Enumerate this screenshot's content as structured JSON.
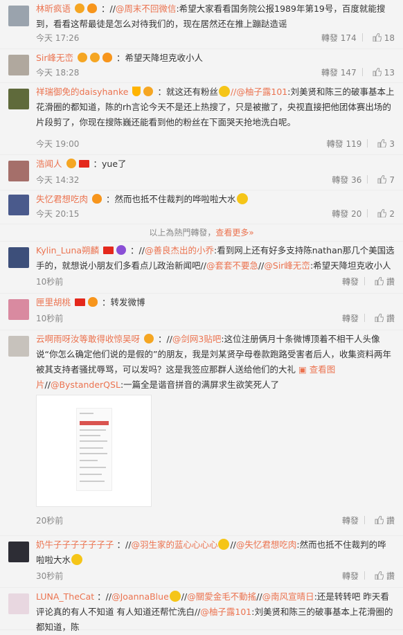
{
  "comments": [
    {
      "user": "林昕疯语",
      "body_prefix": "：//",
      "mention1": "@周末不回微信",
      "text1": ":希望大家看看国务院公报1989年第19号，百度就能搜到，看看这帮最徒是怎么对待我们的，现在居然还在推上蹦跶造谣",
      "time": "今天 17:26",
      "repost": "轉發 174",
      "likes": "18"
    },
    {
      "user": "Sir峰无峦",
      "body_prefix": "：",
      "text1": "希望天降坦克收小人",
      "time": "今天 18:28",
      "repost": "轉發 147",
      "likes": "13"
    },
    {
      "user": "祥瑞御免的daisyhanke",
      "body_prefix": "：就这还有粉丝",
      "mention1": "//@柚子露101",
      "text1": ":刘美贤和陈三的破事基本上花滑圈的都知道，陈的rh言论今天不是还上热搜了，只是被撤了，央视直接把他团体赛出场的片段剪了，你现在搜陈巍还能看到他的粉丝在下面哭天抢地洗白呢。",
      "time": "今天 19:00",
      "repost": "轉發 119",
      "likes": "3"
    },
    {
      "user": "浩闻人",
      "body_prefix": "：",
      "text1": "yue了",
      "time": "今天 14:32",
      "repost": "轉發 36",
      "likes": "7"
    },
    {
      "user": "失忆君想吃肉",
      "body_prefix": "：",
      "text1": "然而也抵不住裁判的哗啦啦大水",
      "time": "今天 20:15",
      "repost": "轉發 20",
      "likes": "2"
    },
    {
      "user": "Kylin_Luna朔麟",
      "body_prefix": "：//",
      "mention1": "@善良杰出的小乔",
      "text1": ":看到网上还有好多支持陈nathan那几个美国选手的，就想说小朋友们多看点儿政治新闻吧//",
      "mention2": "@套套不要急",
      "text2": "//",
      "mention3": "@Sir峰无峦",
      "text3": ":希望天降坦克收小人",
      "time": "10秒前",
      "repost": "轉發",
      "likes": "讚"
    },
    {
      "user": "匣里胡桃",
      "body_prefix": "：",
      "text1": "转发微博",
      "time": "10秒前",
      "repost": "轉發",
      "likes": "讚"
    },
    {
      "user": "云啊雨呀汝等敢得收惊吴呀",
      "body_prefix": "：//",
      "mention1": "@剑网3贴吧",
      "text1": ":这位注册俩月十条微博顶着不相干人头像说“你怎么确定他们说的是假的”的朋友，我是刘某贤孕母卷款跑路受害者后人，收集资料两年被其支持者骚扰辱骂，可以发吗？这是我签应那群人送给他们的大礼",
      "pic_link": "查看图片",
      "text2": "//",
      "mention2": "@BystanderQSL",
      "text3": ":一篇全是谐音拼音的满屏求生欲笑死人了",
      "time": "20秒前",
      "repost": "轉發",
      "likes": "讚"
    },
    {
      "user": "奶牛子子子子子子子",
      "body_prefix": "：//",
      "mention1": "@羽生家的蓝心心心心",
      "text1": "//",
      "mention2": "@失忆君想吃肉",
      "text2": ":然而也抵不住裁判的哗啦啦大水",
      "time": "30秒前",
      "repost": "轉發",
      "likes": "讚"
    },
    {
      "user": "LUNA_TheCat",
      "body_prefix": "：//",
      "mention1": "@JoannaBlue",
      "text1": "//",
      "mention2": "@關愛金毛不動搖",
      "text2": "//",
      "mention3": "@南风宣晴日",
      "text3": ":还是转转吧 昨天看评论真的有人不知道 有人知道还帮忙洗白//",
      "mention4": "@柚子露101",
      "text4": ":刘美贤和陈三的破事基本上花滑圈的都知道，陈"
    }
  ],
  "hot_divider": {
    "text": "以上為熱門轉發，",
    "link": "查看更多»"
  },
  "colors": {
    "accent": "#eb7350",
    "background": "#f4f4f4",
    "meta": "#888888"
  },
  "icons": [
    "thumb-up-icon",
    "flame-badge-icon",
    "vip-badge-icon",
    "china-flag-icon",
    "emoji-icon"
  ]
}
